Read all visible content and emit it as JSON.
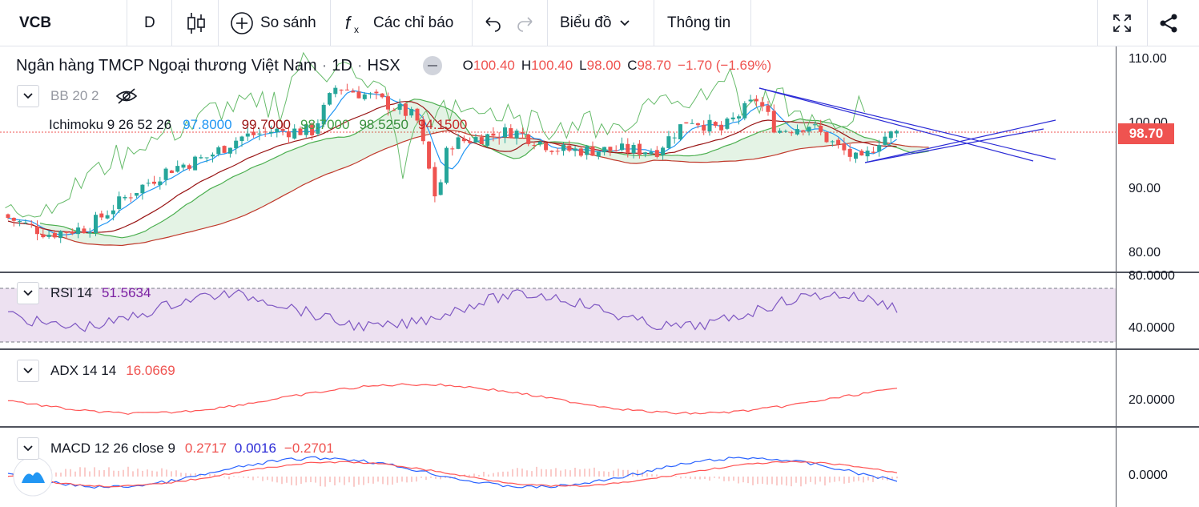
{
  "toolbar": {
    "symbol": "VCB",
    "interval": "D",
    "compare_label": "So sánh",
    "indicators_label": "Các chỉ báo",
    "chart_label": "Biểu đồ",
    "info_label": "Thông tin"
  },
  "header": {
    "title": "Ngân hàng TMCP Ngoại thương Việt Nam",
    "dot1": "·",
    "timeframe": "1D",
    "dot2": "·",
    "exchange": "HSX",
    "o_label": "O",
    "o_value": "100.40",
    "h_label": "H",
    "h_value": "100.40",
    "l_label": "L",
    "l_value": "98.00",
    "c_label": "C",
    "c_value": "98.70",
    "change": "−1.70 (−1.69%)"
  },
  "indicators": {
    "bb": "BB 20 2",
    "ichimoku": {
      "name": "Ichimoku 9 26 52 26",
      "v1": "97.8000",
      "v2": "99.7000",
      "v3": "98.7000",
      "v4": "98.5250",
      "v5": "94.1500"
    },
    "rsi": {
      "name": "RSI 14",
      "value": "51.5634"
    },
    "adx": {
      "name": "ADX 14 14",
      "value": "16.0669"
    },
    "macd": {
      "name": "MACD 12 26 close 9",
      "v1": "0.2717",
      "v2": "0.0016",
      "v3": "−0.2701"
    }
  },
  "price_axis": {
    "p110": "110.00",
    "p100": "100.00",
    "p90": "90.00",
    "p80": "80.00",
    "last_price": "98.70",
    "rsi80": "80.0000",
    "rsi40": "40.0000",
    "adx20": "20.0000",
    "macd0": "0.0000"
  },
  "colors": {
    "up": "#26a69a",
    "down": "#ef5350",
    "tenkan": "#2196f3",
    "kijun": "#991515",
    "chikou": "#4caf50",
    "rsi": "#7e57c2",
    "adx": "#ff5252",
    "macd": "#2962ff",
    "signal": "#ff6d00"
  }
}
